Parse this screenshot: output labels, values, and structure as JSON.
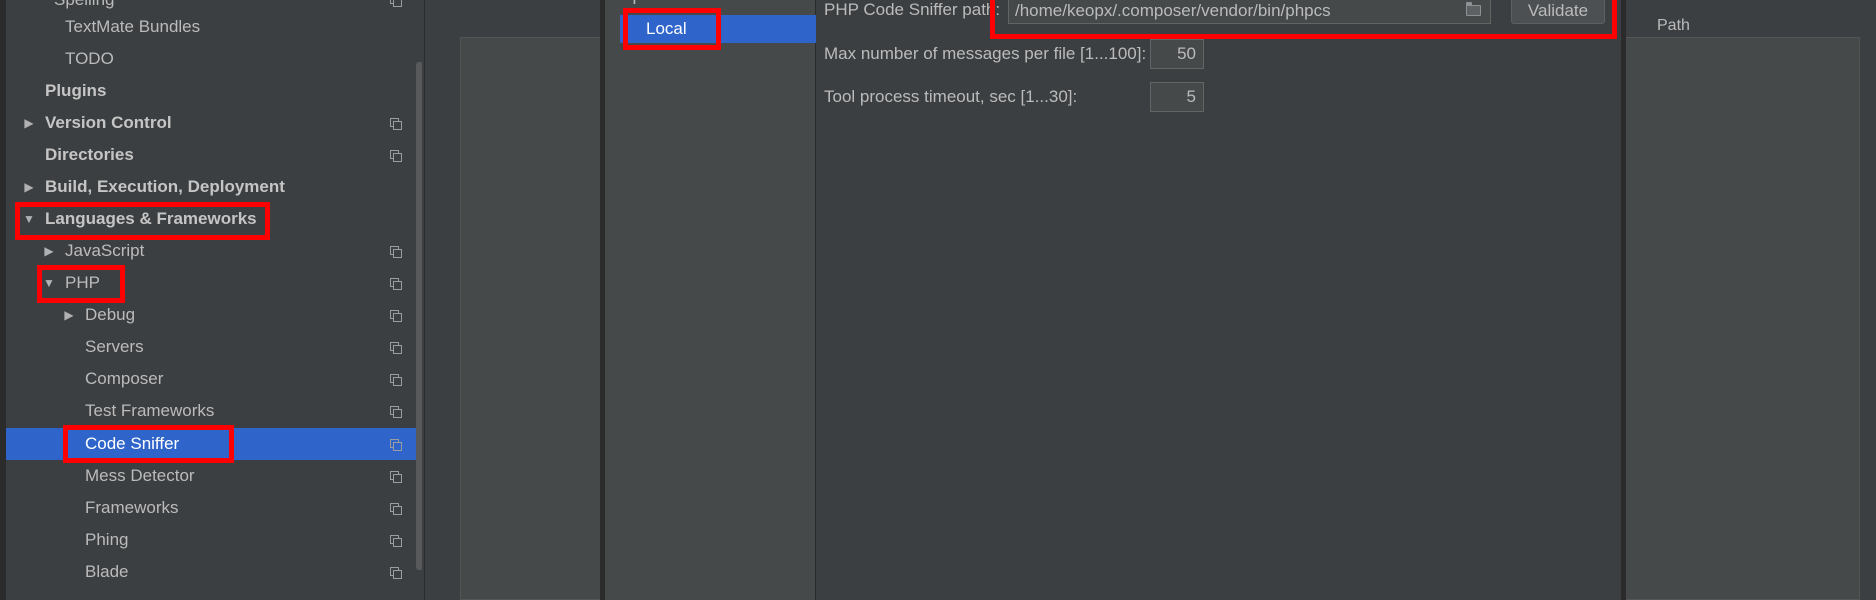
{
  "sidebar": {
    "items": [
      {
        "label": "Spelling",
        "arrow": ""
      },
      {
        "label": "TextMate Bundles",
        "arrow": ""
      },
      {
        "label": "TODO",
        "arrow": ""
      },
      {
        "label": "Plugins",
        "arrow": ""
      },
      {
        "label": "Version Control",
        "arrow": "▶"
      },
      {
        "label": "Directories",
        "arrow": ""
      },
      {
        "label": "Build, Execution, Deployment",
        "arrow": "▶"
      },
      {
        "label": "Languages & Frameworks",
        "arrow": "▼"
      },
      {
        "label": "JavaScript",
        "arrow": "▶"
      },
      {
        "label": "PHP",
        "arrow": "▼"
      },
      {
        "label": "Debug",
        "arrow": "▶"
      },
      {
        "label": "Servers",
        "arrow": ""
      },
      {
        "label": "Composer",
        "arrow": ""
      },
      {
        "label": "Test Frameworks",
        "arrow": ""
      },
      {
        "label": "Code Sniffer",
        "arrow": ""
      },
      {
        "label": "Mess Detector",
        "arrow": ""
      },
      {
        "label": "Frameworks",
        "arrow": ""
      },
      {
        "label": "Phing",
        "arrow": ""
      },
      {
        "label": "Blade",
        "arrow": ""
      }
    ]
  },
  "background": {
    "path_header": "Path"
  },
  "dialog": {
    "add_symbol": "+",
    "interpreters": [
      {
        "label": "Local"
      }
    ],
    "codesniffer_path_label": "PHP Code Sniffer path:",
    "codesniffer_path_value": "/home/keopx/.composer/vendor/bin/phpcs",
    "validate_label": "Validate",
    "max_messages_label": "Max number of messages per file [1...100]:",
    "max_messages_value": "50",
    "timeout_label": "Tool process timeout, sec [1...30]:",
    "timeout_value": "5"
  },
  "colors": {
    "selection": "#2f65ca",
    "highlight_box": "#ff0000",
    "panel": "#3c3f41"
  },
  "icons": {
    "tree_action": "copy-icon",
    "browse": "folder-icon"
  }
}
